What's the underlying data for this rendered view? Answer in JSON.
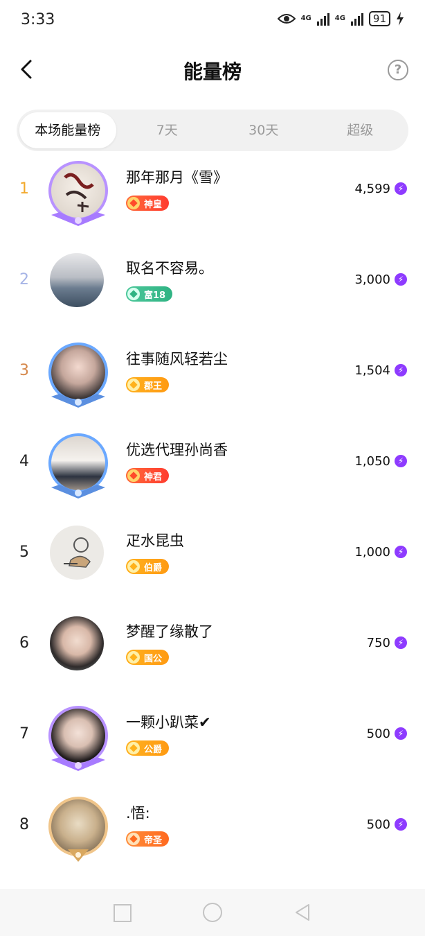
{
  "status": {
    "time": "3:33",
    "net1": "4G",
    "net2": "4G",
    "battery": "91"
  },
  "header": {
    "title": "能量榜",
    "help": "?"
  },
  "tabs": [
    "本场能量榜",
    "7天",
    "30天",
    "超级"
  ],
  "rows": [
    {
      "rank": "1",
      "name": "那年那月《雪》",
      "badge": "神皇",
      "score": "4,599"
    },
    {
      "rank": "2",
      "name": "取名不容易。",
      "badge": "富18",
      "score": "3,000"
    },
    {
      "rank": "3",
      "name": "往事随风轻若尘",
      "badge": "郡王",
      "score": "1,504"
    },
    {
      "rank": "4",
      "name": "优选代理孙尚香",
      "badge": "神君",
      "score": "1,050"
    },
    {
      "rank": "5",
      "name": "疋水昆虫",
      "badge": "伯爵",
      "score": "1,000"
    },
    {
      "rank": "6",
      "name": "梦醒了缘散了",
      "badge": "国公",
      "score": "750"
    },
    {
      "rank": "7",
      "name": "一颗小趴菜✔",
      "badge": "公爵",
      "score": "500"
    },
    {
      "rank": "8",
      "name": ".悟:",
      "badge": "帝圣",
      "score": "500"
    }
  ],
  "colors": {
    "energy": "#8e3bff",
    "rank1": "#f2a92c",
    "rank2": "#a6b4e6",
    "rank3": "#d5874a"
  }
}
